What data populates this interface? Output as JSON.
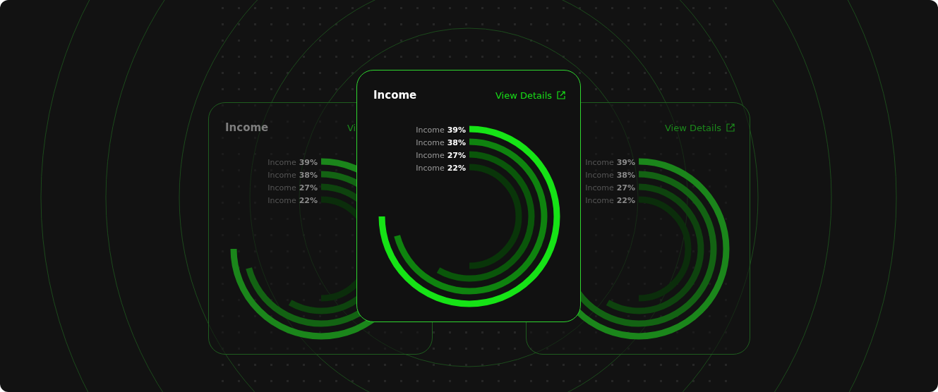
{
  "cards": [
    {
      "title": "Income",
      "link": "Vi",
      "link_icon": false,
      "dimmed": true,
      "items": [
        {
          "label": "Income",
          "value": "39%",
          "color": "#1b861b"
        },
        {
          "label": "Income",
          "value": "38%",
          "color": "#136313"
        },
        {
          "label": "Income",
          "value": "27%",
          "color": "#0e430e"
        },
        {
          "label": "Income",
          "value": "22%",
          "color": "#0b2d0b"
        }
      ]
    },
    {
      "title": "Income",
      "link": "View Details",
      "link_icon": true,
      "dimmed": false,
      "items": [
        {
          "label": "Income",
          "value": "39%",
          "color": "#16e316"
        },
        {
          "label": "Income",
          "value": "38%",
          "color": "#0f830f"
        },
        {
          "label": "Income",
          "value": "27%",
          "color": "#0a560a"
        },
        {
          "label": "Income",
          "value": "22%",
          "color": "#093509"
        }
      ]
    },
    {
      "link": "View Details",
      "link_icon": true,
      "dimmed": true,
      "items": [
        {
          "label": "Income",
          "value": "39%",
          "color": "#1b861b"
        },
        {
          "label": "Income",
          "value": "38%",
          "color": "#136313"
        },
        {
          "label": "Income",
          "value": "27%",
          "color": "#0e430e"
        },
        {
          "label": "Income",
          "value": "22%",
          "color": "#0b2d0b"
        }
      ]
    }
  ]
}
